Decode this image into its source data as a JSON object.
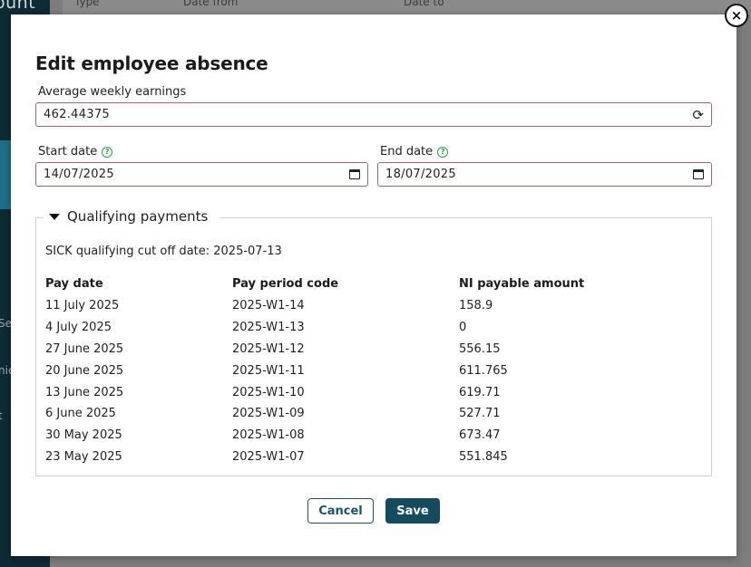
{
  "background": {
    "logo_fragment": "ount",
    "header_fragments": [
      "Type",
      "Date from",
      "Date to"
    ],
    "side_fragments": [
      "Se",
      "nie",
      "t"
    ]
  },
  "modal": {
    "title": "Edit employee absence",
    "average_weekly_earnings": {
      "label": "Average weekly earnings",
      "value": "462.44375"
    },
    "start_date": {
      "label": "Start date",
      "value": "14/07/2025"
    },
    "end_date": {
      "label": "End date",
      "value": "18/07/2025"
    },
    "qualifying_payments": {
      "legend": "Qualifying payments",
      "cutoff_text": "SICK qualifying cut off date: 2025-07-13",
      "headers": [
        "Pay date",
        "Pay period code",
        "NI payable amount"
      ],
      "rows": [
        [
          "11 July 2025",
          "2025-W1-14",
          "158.9"
        ],
        [
          "4 July 2025",
          "2025-W1-13",
          "0"
        ],
        [
          "27 June 2025",
          "2025-W1-12",
          "556.15"
        ],
        [
          "20 June 2025",
          "2025-W1-11",
          "611.765"
        ],
        [
          "13 June 2025",
          "2025-W1-10",
          "619.71"
        ],
        [
          "6 June 2025",
          "2025-W1-09",
          "527.71"
        ],
        [
          "30 May 2025",
          "2025-W1-08",
          "673.47"
        ],
        [
          "23 May 2025",
          "2025-W1-07",
          "551.845"
        ]
      ]
    },
    "cancel_label": "Cancel",
    "save_label": "Save",
    "close_glyph": "×"
  }
}
